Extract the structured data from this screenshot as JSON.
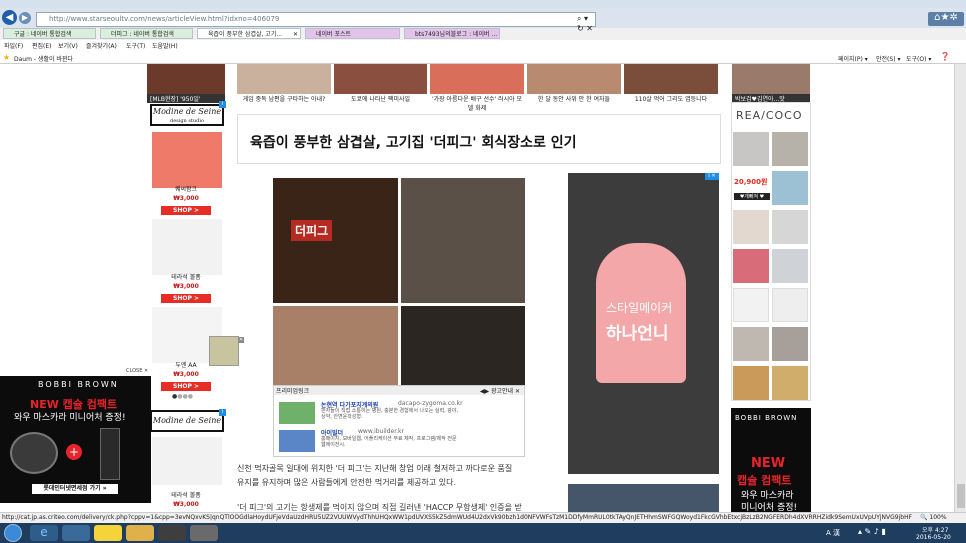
{
  "browser": {
    "url": "http://www.starseoultv.com/news/articleView.html?idxno=406079",
    "tabs": [
      "구글 : 네이버 통합검색",
      "더피그 : 네이버 통합검색",
      "육즙이 풍부한 삼겹살, 고기...",
      "네이버 포스트",
      "bts7493님의블로그 : 네이버 ..."
    ],
    "menu": [
      "파일(F)",
      "편집(E)",
      "보기(V)",
      "즐겨찾기(A)",
      "도구(T)",
      "도움말(H)"
    ],
    "favorites": "Daum - 생활이 바뀐다",
    "toolbar_right": [
      "페이지(P) ▾",
      "안전(S) ▾",
      "도구(O) ▾"
    ]
  },
  "top_strip": {
    "left_caption": "[MLB현장] '950일'",
    "captions": [
      "게임 중독 남편을 구타하는 아내?",
      "도쿄에 나타난 팩미사일",
      "'가장 아름다운 배구 선수' 러시아 모델 화제",
      "한 달 동안 사위 안 한 여자들",
      "110살 먹어 그리도 엽등니다"
    ],
    "right_caption": "박보검♥김연아...맛"
  },
  "left_ads": {
    "brand": "Modine de Seine",
    "brand_sub": "design studio",
    "products": [
      {
        "name": "퀘씨팜크",
        "price": "₩3,000",
        "shop": "SHOP >"
      },
      {
        "name": "테라석 볼폼",
        "price": "₩3,000",
        "shop": "SHOP >"
      },
      {
        "name": "두엔 AA",
        "price": "₩3,000",
        "shop": "SHOP >"
      }
    ],
    "brand2": "Modine de Seine",
    "product4": {
      "name": "테라석 볼폼",
      "price": "₩3,000"
    }
  },
  "close_label": "CLOSE ✕",
  "left_popup": {
    "brand": "BOBBI BROWN",
    "line1": "NEW 캡슐 컴팩트",
    "line2": "와우 마스카라 미니어처 증정!",
    "button": "롯데인터넷면세점 가기 »"
  },
  "article": {
    "headline": "육즙이 풍부한 삼겹살, 고기집 '더피그' 회식장소로 인기",
    "sign": "더피그",
    "para1": "신천 먹자골목 일대에 위치한 '더 피그'는 지난해 창업 이래 철저하고 까다로운 품질",
    "para2": "유지를 유지하며 많은 사람들에게 안전한 먹거리를 제공하고 있다.",
    "para3": "'더 피그'의 고기는 항생제를 먹이지 않으며 직접 길러낸 'HACCP 무항생제' 인증을 받"
  },
  "inner_ad": {
    "header": "프리미엄링크",
    "header_right": "◀▶  광고안내 ✕",
    "items": [
      {
        "title": "논현역 다가포지게의원",
        "url": "dacapo-zygoma.co.kr",
        "desc": "판자들이 직접 소통하는 병원, 충분한 경험에서 나오는 실력, 광야, 상약, 안면윤곽성형."
      },
      {
        "title": "아이빌더",
        "url": "www.ibuilder.kr",
        "desc": "홈페이지, 모바일웹, 어플리케이션 무료 제작, 프로그램/제작 전문 웹에이전시."
      }
    ]
  },
  "side_ad": {
    "line1": "스타일메이커",
    "line2": "하나언니"
  },
  "right_ads": {
    "brand": "REA/COCO",
    "price_tag": "20,900원",
    "label": "♥개빠져 ♥",
    "brand2": "BOBBI BROWN",
    "line1": "NEW",
    "line2": "캡슐 컴팩트",
    "line3": "와우 마스카라",
    "line4": "미니어처 증정!"
  },
  "status_bar": {
    "url": "http://cat.jp.as.criteo.com/delivery/ck.php?cppv=1&cpp=3evNQxvKS|qnQTlOOGdlaHoydUFjeVdaUzdHRU5UZ2VUUWVydThhUHQxWW1pdUVXS5kZ5dmWUd4U2dxVk90bzh1d0NFVWFsTzM1DDfyMmRUL0tkTAyQnJETHhmSWFGQWoyd1FkcGVhbEtxcjBzLzB2NGFERDh4dXVRRHZidk9SemUxUVpUYjNVG9jbHFjK3pzRW9aQ0hMWTlS",
    "zoom": "🔍 100%"
  },
  "taskbar": {
    "ime": "A 漢",
    "time": "오후 4:27",
    "date": "2016-05-20"
  },
  "colors": {
    "accent": "#e62c24",
    "sidead": "#f4a7a8",
    "red": "#d01414"
  }
}
